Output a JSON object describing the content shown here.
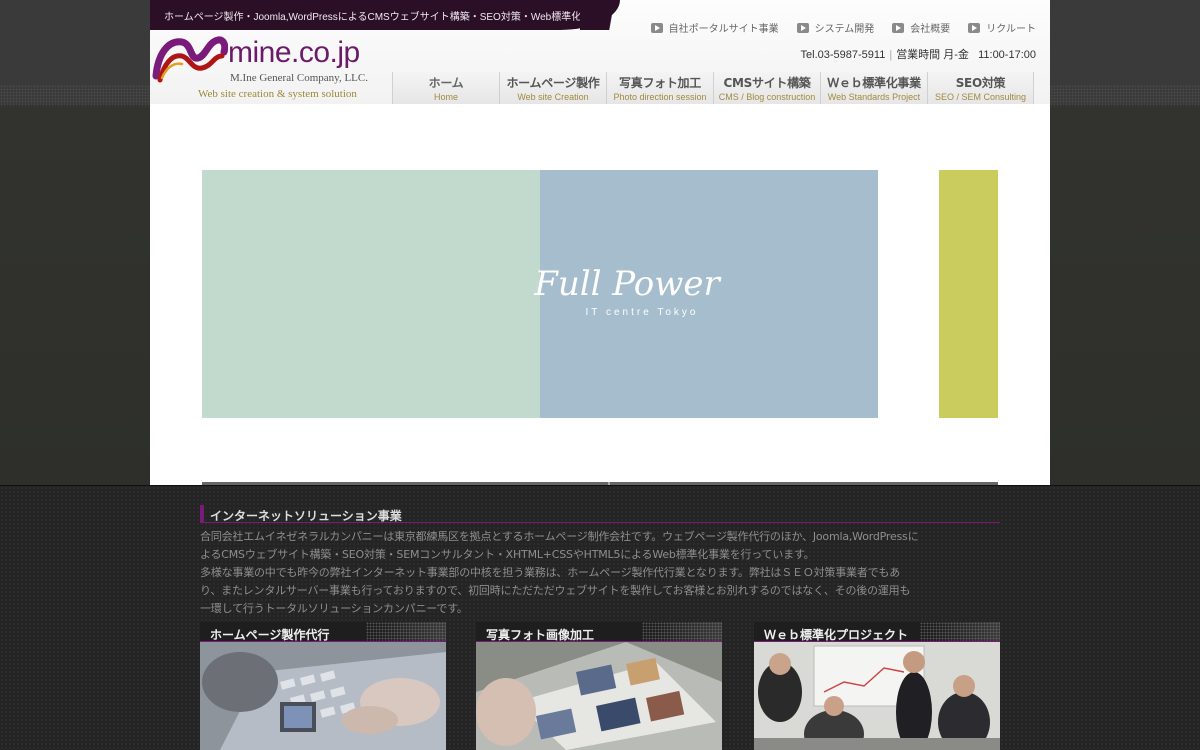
{
  "header": {
    "tagline": "ホームページ製作・Joomla,WordPressによるCMSウェブサイト構築・SEO対策・Web標準化事業",
    "util_nav": [
      {
        "label": "自社ポータルサイト事業",
        "icon": "arrow-right-icon"
      },
      {
        "label": "システム開発",
        "icon": "arrow-right-icon"
      },
      {
        "label": "会社概要",
        "icon": "arrow-right-icon"
      },
      {
        "label": "リクルート",
        "icon": "arrow-right-icon"
      }
    ],
    "tel": "Tel.03-5987-5911",
    "hours_label": "営業時間 月-金",
    "hours": "11:00-17:00"
  },
  "logo": {
    "name": "mine.co.jp",
    "company": "M.Ine General Company, LLC.",
    "slogan": "Web site creation & system solution"
  },
  "main_nav": [
    {
      "jp": "ホーム",
      "en": "Home"
    },
    {
      "jp": "ホームページ製作",
      "en": "Web site Creation"
    },
    {
      "jp": "写真フォト加工",
      "en": "Photo direction session"
    },
    {
      "jp": "CMSサイト構築",
      "en": "CMS / Blog construction"
    },
    {
      "jp": "Ｗｅｂ標準化事業",
      "en": "Web Standards Project"
    },
    {
      "jp": "SEO対策",
      "en": "SEO / SEM Consulting"
    }
  ],
  "hero": {
    "title": "Full Power",
    "subtitle": "IT centre  Tokyo"
  },
  "section": {
    "title": "インターネットソリューション事業",
    "lines": [
      "合同会社エムイネゼネラルカンパニーは東京都練馬区を拠点とするホームページ制作会社です。ウェブページ製作代行のほか、Joomla,WordPressに",
      "よるCMSウェブサイト構築・SEO対策・SEMコンサルタント・XHTML+CSSやHTML5によるWeb標準化事業を行っています。",
      "多様な事業の中でも昨今の弊社インターネット事業部の中核を担う業務は、ホームページ製作代行業となります。弊社はＳＥＯ対策事業者でもあ",
      "り、またレンタルサーバー事業も行っておりますので、初回時にただただウェブサイトを製作してお客様とお別れするのではなく、その後の運用も",
      "一環して行うトータルソリューションカンパニーです。"
    ]
  },
  "cards": [
    {
      "title": "ホームページ製作代行"
    },
    {
      "title": "写真フォト画像加工"
    },
    {
      "title": "Ｗｅｂ標準化プロジェクト"
    }
  ],
  "colors": {
    "accent": "#7a1a7a",
    "tagline_bg": "#2a0f26",
    "gold": "#a08a40",
    "slide_green": "#c2d9cd",
    "slide_blue": "#a5bdcc",
    "slide_yellow": "#cbcc5e"
  }
}
